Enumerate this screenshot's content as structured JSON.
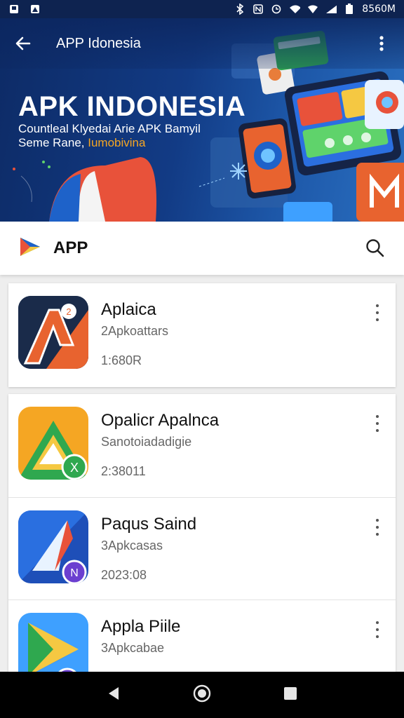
{
  "status_bar": {
    "time": "8560M"
  },
  "app_bar": {
    "title": "APP Idonesia"
  },
  "banner": {
    "headline": "APK INDONESIA",
    "line1": "Countleal Klyedai Arie APK Bamyil",
    "line2_plain": "Seme Rane, ",
    "line2_accent": "Iumobivina"
  },
  "search": {
    "label": "APP"
  },
  "apps": [
    {
      "name": "Aplaica",
      "subtitle": "2Apkoattars",
      "meta": "1:680R",
      "icon": "orange-a-app-icon",
      "badge": "2"
    },
    {
      "name": "Opalicr Apalnca",
      "subtitle": "Sanotoiadadigie",
      "meta": "2:38011",
      "icon": "drive-style-app-icon",
      "badge": "X"
    },
    {
      "name": "Paqus Saind",
      "subtitle": "3Apkcasas",
      "meta": "2023:08",
      "icon": "blue-a-app-icon",
      "badge": "N"
    },
    {
      "name": "Appla Piile",
      "subtitle": "3Apkcabae",
      "meta": "",
      "icon": "play-style-app-icon",
      "badge": ""
    }
  ],
  "colors": {
    "banner": "#123b85",
    "status": "#0e2350",
    "accent": "#f5a623"
  }
}
